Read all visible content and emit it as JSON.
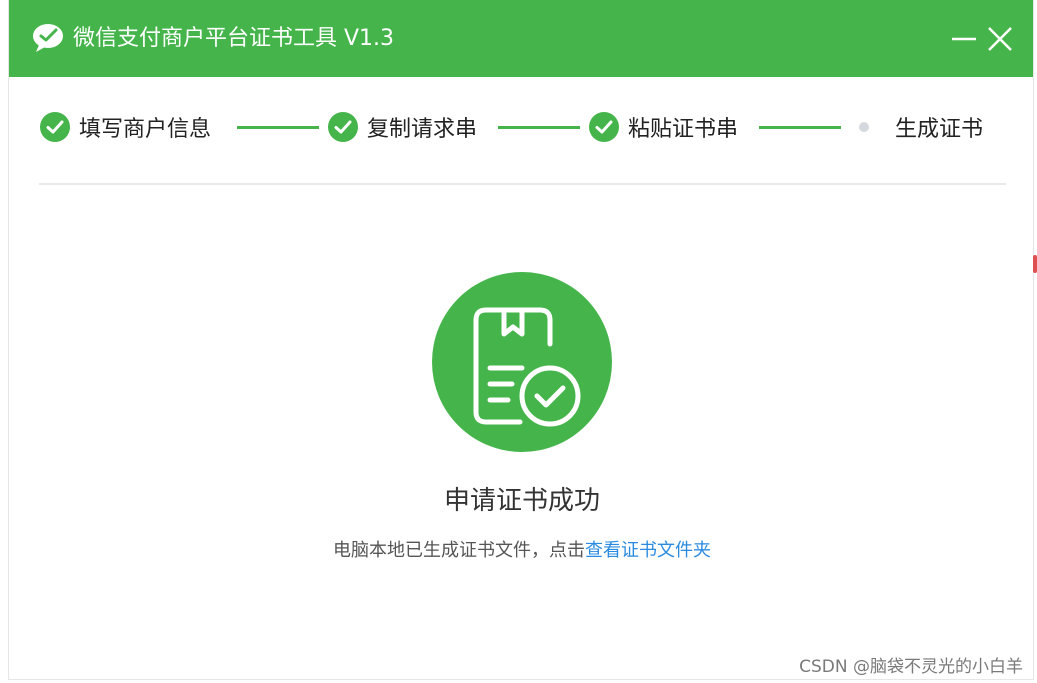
{
  "window": {
    "title": "微信支付商户平台证书工具 V1.3",
    "logo_icon": "wechat-icon",
    "minimize_icon": "minimize-icon",
    "close_icon": "close-icon",
    "accent_color": "#45b54b"
  },
  "steps": [
    {
      "label": "填写商户信息",
      "status": "done",
      "icon": "check-circle-icon"
    },
    {
      "label": "复制请求串",
      "status": "done",
      "icon": "check-circle-icon"
    },
    {
      "label": "粘贴证书串",
      "status": "done",
      "icon": "check-circle-icon"
    },
    {
      "label": "生成证书",
      "status": "current",
      "icon": "dot-icon"
    }
  ],
  "result": {
    "icon": "certificate-check-icon",
    "title": "申请证书成功",
    "description": "电脑本地已生成证书文件，点击",
    "link_label": "查看证书文件夹",
    "link_color": "#2a8be0"
  },
  "watermark": "CSDN @脑袋不灵光的小白羊"
}
